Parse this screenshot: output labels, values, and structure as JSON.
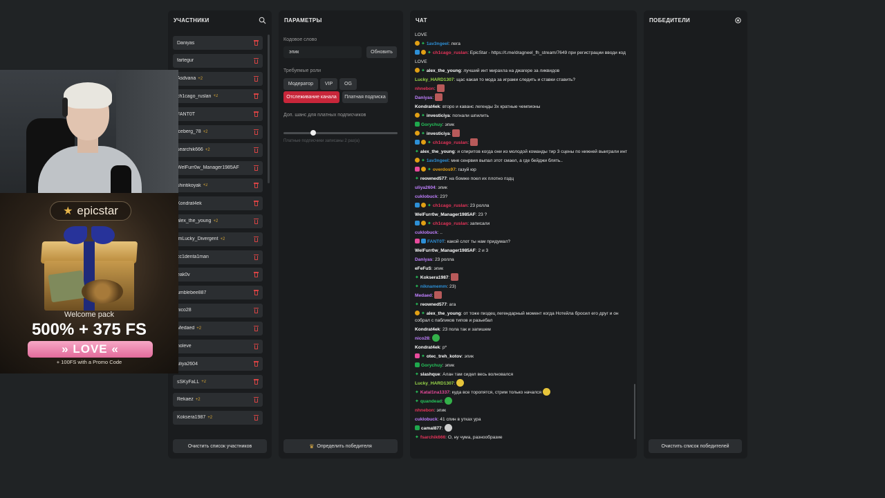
{
  "participants": {
    "title": "УЧАСТНИКИ",
    "search_icon": "search-icon",
    "items": [
      {
        "name": "Daniyas",
        "count": ""
      },
      {
        "name": "fartegur",
        "count": ""
      },
      {
        "name": "Asdvana",
        "count": "+2"
      },
      {
        "name": "ch1cago_ruslan",
        "count": "+2"
      },
      {
        "name": "FANT0T",
        "count": ""
      },
      {
        "name": "iceberg_78",
        "count": "+2"
      },
      {
        "name": "searchik666",
        "count": "+2"
      },
      {
        "name": "WelFurr0w_Manager1985AF",
        "count": ""
      },
      {
        "name": "shintikoyak",
        "count": "+2"
      },
      {
        "name": "Kondrat4ek",
        "count": ""
      },
      {
        "name": "alex_the_young",
        "count": "+2"
      },
      {
        "name": "imLucky_Divergent",
        "count": "+2"
      },
      {
        "name": "cc1denta1man",
        "count": ""
      },
      {
        "name": "eak0v",
        "count": ""
      },
      {
        "name": "umblebee887",
        "count": ""
      },
      {
        "name": "nico28",
        "count": ""
      },
      {
        "name": "Medaed",
        "count": "+2"
      },
      {
        "name": "noleve",
        "count": ""
      },
      {
        "name": "uliya2604",
        "count": ""
      },
      {
        "name": "sSKyFaLL",
        "count": "+2"
      },
      {
        "name": "Rekaez",
        "count": "+2"
      },
      {
        "name": "Koksera1987",
        "count": "+2"
      }
    ],
    "clear_button": "Очистить список участников"
  },
  "params": {
    "title": "ПАРАМЕТРЫ",
    "keyword_label": "Кодовое слово",
    "keyword_value": "эпик",
    "update_button": "Обновить",
    "roles_label": "Требуемые роли",
    "roles": [
      "Модератор",
      "VIP",
      "OG"
    ],
    "mode_active": "Отслеживание канала",
    "mode_paid": "Платная подписка",
    "chance_label": "Доп. шанс для платных подписчиков",
    "chance_value": 0.26,
    "hint": "Платные подписчики записаны 2 раз(а)",
    "pick_button": "Определить победителя"
  },
  "chat": {
    "title": "ЧАТ",
    "messages": [
      {
        "badges": [],
        "user": "",
        "color": "#e6e6e6",
        "text": "LOVE",
        "emote": ""
      },
      {
        "badges": [
          "sub",
          "star"
        ],
        "user": "1av3ngeel",
        "color": "#2d8fd6",
        "text": ": лега",
        "emote": ""
      },
      {
        "badges": [
          "tw",
          "sub",
          "star"
        ],
        "user": "ch1cago_ruslan",
        "color": "#e8345a",
        "text": ": EpicStar - https://t.me/dragneel_fh_stream/7649 при регистрации вводи код",
        "emote": "",
        "wrap": true
      },
      {
        "badges": [],
        "user": "",
        "color": "#e6e6e6",
        "text": "LOVE",
        "emote": ""
      },
      {
        "badges": [
          "sub",
          "star"
        ],
        "user": "alex_the_young",
        "color": "#ffffff",
        "text": ": лучший инт мирахла на джагере за ликвидов",
        "emote": ""
      },
      {
        "badges": [],
        "user": "Lucky_HARD1307",
        "color": "#9ad94a",
        "text": ": щас какая то мода за играми следить и ставки ставить?",
        "emote": ""
      },
      {
        "badges": [],
        "user": "nhnebon",
        "color": "#e8345a",
        "text": ":",
        "emote": "p"
      },
      {
        "badges": [],
        "user": "Daniyas",
        "color": "#c080ff",
        "text": ":",
        "emote": "p"
      },
      {
        "badges": [],
        "user": "Kondrat4ek",
        "color": "#ffffff",
        "text": ": второ и каванс легенды 3х кратные чемпионы",
        "emote": ""
      },
      {
        "badges": [
          "sub",
          "star"
        ],
        "user": "investiciya",
        "color": "#ffffff",
        "text": ": погнали шпилить",
        "emote": ""
      },
      {
        "badges": [
          "mod"
        ],
        "user": "Gorychuy",
        "color": "#26c65c",
        "text": ": эпик",
        "emote": ""
      },
      {
        "badges": [
          "sub",
          "star"
        ],
        "user": "investiciya",
        "color": "#ffffff",
        "text": ":",
        "emote": "p"
      },
      {
        "badges": [
          "tw",
          "sub",
          "star"
        ],
        "user": "ch1cago_ruslan",
        "color": "#e8345a",
        "text": ":",
        "emote": "p"
      },
      {
        "badges": [
          "star"
        ],
        "user": "alex_the_young",
        "color": "#ffffff",
        "text": ": и спиритов когда они из молодой команды тир 3 сцены по нижней выиграли инт",
        "emote": "",
        "wrap": true
      },
      {
        "badges": [
          "sub",
          "star"
        ],
        "user": "1av3ngeel",
        "color": "#2d8fd6",
        "text": ": мне сенрвия выпал этот смаел, а где бейджи блять..",
        "emote": ""
      },
      {
        "badges": [
          "vip",
          "sub",
          "star"
        ],
        "user": "overdos97",
        "color": "#e09f14",
        "text": ": газуй юр",
        "emote": ""
      },
      {
        "badges": [
          "star"
        ],
        "user": "reowned577",
        "color": "#ffffff",
        "text": ": на бомже поел их плотно пздц",
        "emote": ""
      },
      {
        "badges": [],
        "user": "uliya2604",
        "color": "#c080ff",
        "text": ": эпик",
        "emote": ""
      },
      {
        "badges": [],
        "user": "cuklobuck",
        "color": "#c080ff",
        "text": ": 23?",
        "emote": ""
      },
      {
        "badges": [
          "tw",
          "sub",
          "star"
        ],
        "user": "ch1cago_ruslan",
        "color": "#e8345a",
        "text": ": 23 ролла",
        "emote": ""
      },
      {
        "badges": [],
        "user": "WelFurr0w_Manager1985AF",
        "color": "#ffffff",
        "text": ": 23 ?",
        "emote": ""
      },
      {
        "badges": [
          "tw",
          "sub",
          "star"
        ],
        "user": "ch1cago_ruslan",
        "color": "#e8345a",
        "text": ": записали",
        "emote": ""
      },
      {
        "badges": [],
        "user": "cuklobuck",
        "color": "#c080ff",
        "text": ": ..",
        "emote": ""
      },
      {
        "badges": [
          "vip",
          "tw"
        ],
        "user": "FANT0T",
        "color": "#2d8fd6",
        "text": ": какой слот ты нам придумал?",
        "emote": ""
      },
      {
        "badges": [],
        "user": "WelFurr0w_Manager1985AF",
        "color": "#ffffff",
        "text": ": 2 и 3",
        "emote": ""
      },
      {
        "badges": [],
        "user": "Daniyas",
        "color": "#c080ff",
        "text": ": 23 ролла",
        "emote": ""
      },
      {
        "badges": [],
        "user": "eFeFuS",
        "color": "#ffffff",
        "text": ": эпик",
        "emote": ""
      },
      {
        "badges": [
          "star"
        ],
        "user": "Koksera1987",
        "color": "#ffffff",
        "text": ":",
        "emote": "p"
      },
      {
        "badges": [
          "star"
        ],
        "user": "niknamemm",
        "color": "#2d8fd6",
        "text": ": 23)",
        "emote": ""
      },
      {
        "badges": [],
        "user": "Medaed",
        "color": "#c080ff",
        "text": ":",
        "emote": "p"
      },
      {
        "badges": [
          "star"
        ],
        "user": "reowned577",
        "color": "#ffffff",
        "text": ": ага",
        "emote": ""
      },
      {
        "badges": [
          "sub",
          "star"
        ],
        "user": "alex_the_young",
        "color": "#ffffff",
        "text": ": от тоже пиздец легендарный момент когда Нотейла бросил его друг и он собрал с пабликов типов и разьебал",
        "emote": "",
        "wrap": true
      },
      {
        "badges": [],
        "user": "Kondrat4ek",
        "color": "#ffffff",
        "text": ": 23 пола так и запишем",
        "emote": ""
      },
      {
        "badges": [],
        "user": "nico28",
        "color": "#c080ff",
        "text": ":",
        "emote": "g"
      },
      {
        "badges": [],
        "user": "Kondrat4ek",
        "color": "#ffffff",
        "text": ": р*",
        "emote": ""
      },
      {
        "badges": [
          "vip",
          "star"
        ],
        "user": "otec_treh_kotov",
        "color": "#ffffff",
        "text": ": эпик",
        "emote": ""
      },
      {
        "badges": [
          "mod"
        ],
        "user": "Gorychuy",
        "color": "#26c65c",
        "text": ": эпик",
        "emote": ""
      },
      {
        "badges": [
          "star"
        ],
        "user": "slashque",
        "color": "#ffffff",
        "text": ": Алан там сидел весь волновался",
        "emote": ""
      },
      {
        "badges": [],
        "user": "Lucky_HARD1307",
        "color": "#9ad94a",
        "text": ":",
        "emote": "y"
      },
      {
        "badges": [
          "star"
        ],
        "user": "Katal1na1337",
        "color": "#e84a9c",
        "text": ": куда все торопятся, стрим только начался",
        "emote": "y"
      },
      {
        "badges": [
          "star"
        ],
        "user": "quandead",
        "color": "#26c65c",
        "text": ":",
        "emote": "g"
      },
      {
        "badges": [],
        "user": "nhnebon",
        "color": "#e8345a",
        "text": ": эпик",
        "emote": ""
      },
      {
        "badges": [],
        "user": "cuklobuck",
        "color": "#c080ff",
        "text": ": 41 спин в утках ура",
        "emote": ""
      },
      {
        "badges": [
          "mod"
        ],
        "user": "camal877",
        "color": "#ffffff",
        "text": ":",
        "emote": "w"
      },
      {
        "badges": [
          "star"
        ],
        "user": "fsarchik666",
        "color": "#e8345a",
        "text": ": О, ну чума, разнообразие",
        "emote": ""
      }
    ]
  },
  "winners": {
    "title": "ПОБЕДИТЕЛИ",
    "icon": "reset-icon",
    "clear_button": "Очистить список победителей"
  },
  "ad": {
    "brand": "epicstar",
    "line1": "Welcome pack",
    "line2": "500% + 375 FS",
    "promo": "» LOVE «",
    "line3": "+ 100FS with a Promo Code"
  },
  "colors": {
    "accent_red": "#c8263a",
    "panel": "#1a1c1e",
    "background": "#202325"
  }
}
